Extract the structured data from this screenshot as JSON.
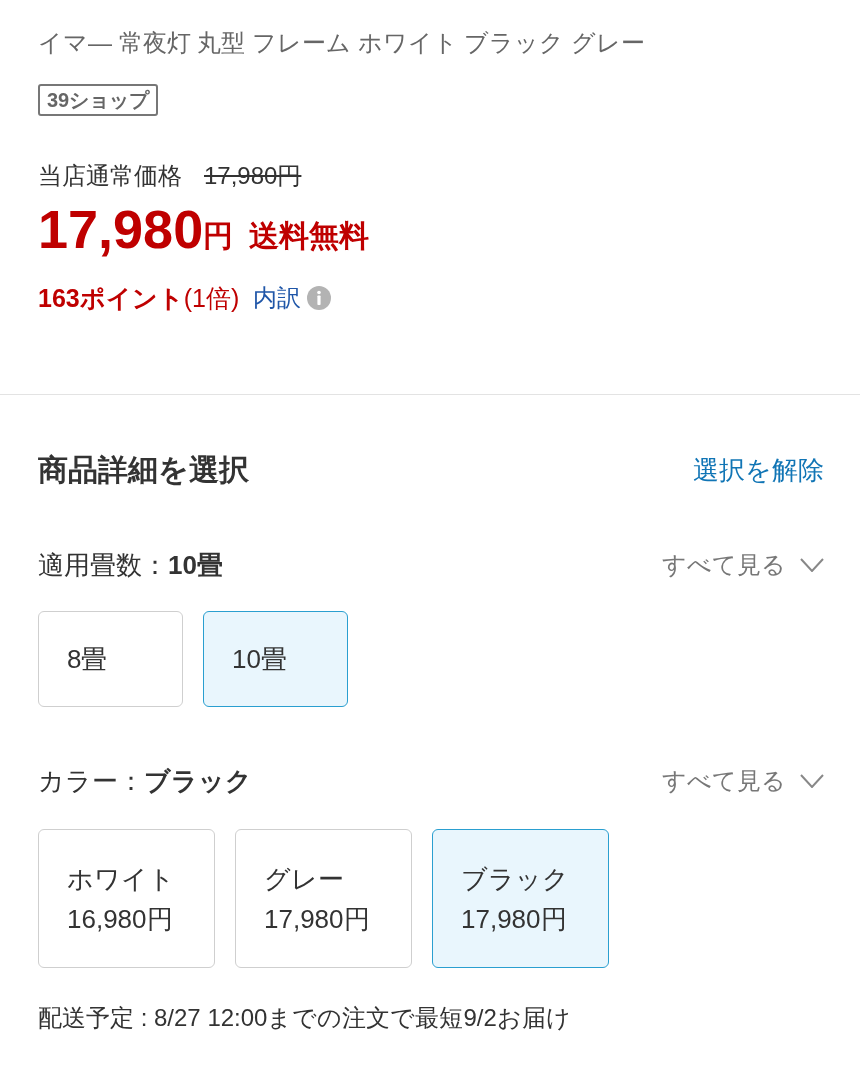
{
  "product": {
    "title": "イマ― 常夜灯 丸型 フレーム ホワイト ブラック グレー",
    "badge": "39ショップ"
  },
  "price": {
    "regular_label": "当店通常価格",
    "regular_price": "17,980円",
    "amount": "17,980",
    "currency": "円",
    "shipping": "送料無料",
    "points": "**163ポイント**(1倍)",
    "breakdown_link": "内訳"
  },
  "selection": {
    "title": "商品詳細を選択",
    "clear_link": "選択を解除",
    "groups": [
      {
        "label": "適用畳数：**10畳**",
        "see_all": "すべて見る",
        "options": [
          {
            "name": "8畳",
            "selected": false
          },
          {
            "name": "10畳",
            "selected": true
          }
        ]
      },
      {
        "label": "カラー：**ブラック**",
        "see_all": "すべて見る",
        "options": [
          {
            "name": "ホワイト",
            "price": "16,980円",
            "selected": false
          },
          {
            "name": "グレー",
            "price": "17,980円",
            "selected": false
          },
          {
            "name": "ブラック",
            "price": "17,980円",
            "selected": true
          }
        ]
      }
    ]
  },
  "delivery": "配送予定 : 8/27 12:00までの注文で最短9/2お届け"
}
